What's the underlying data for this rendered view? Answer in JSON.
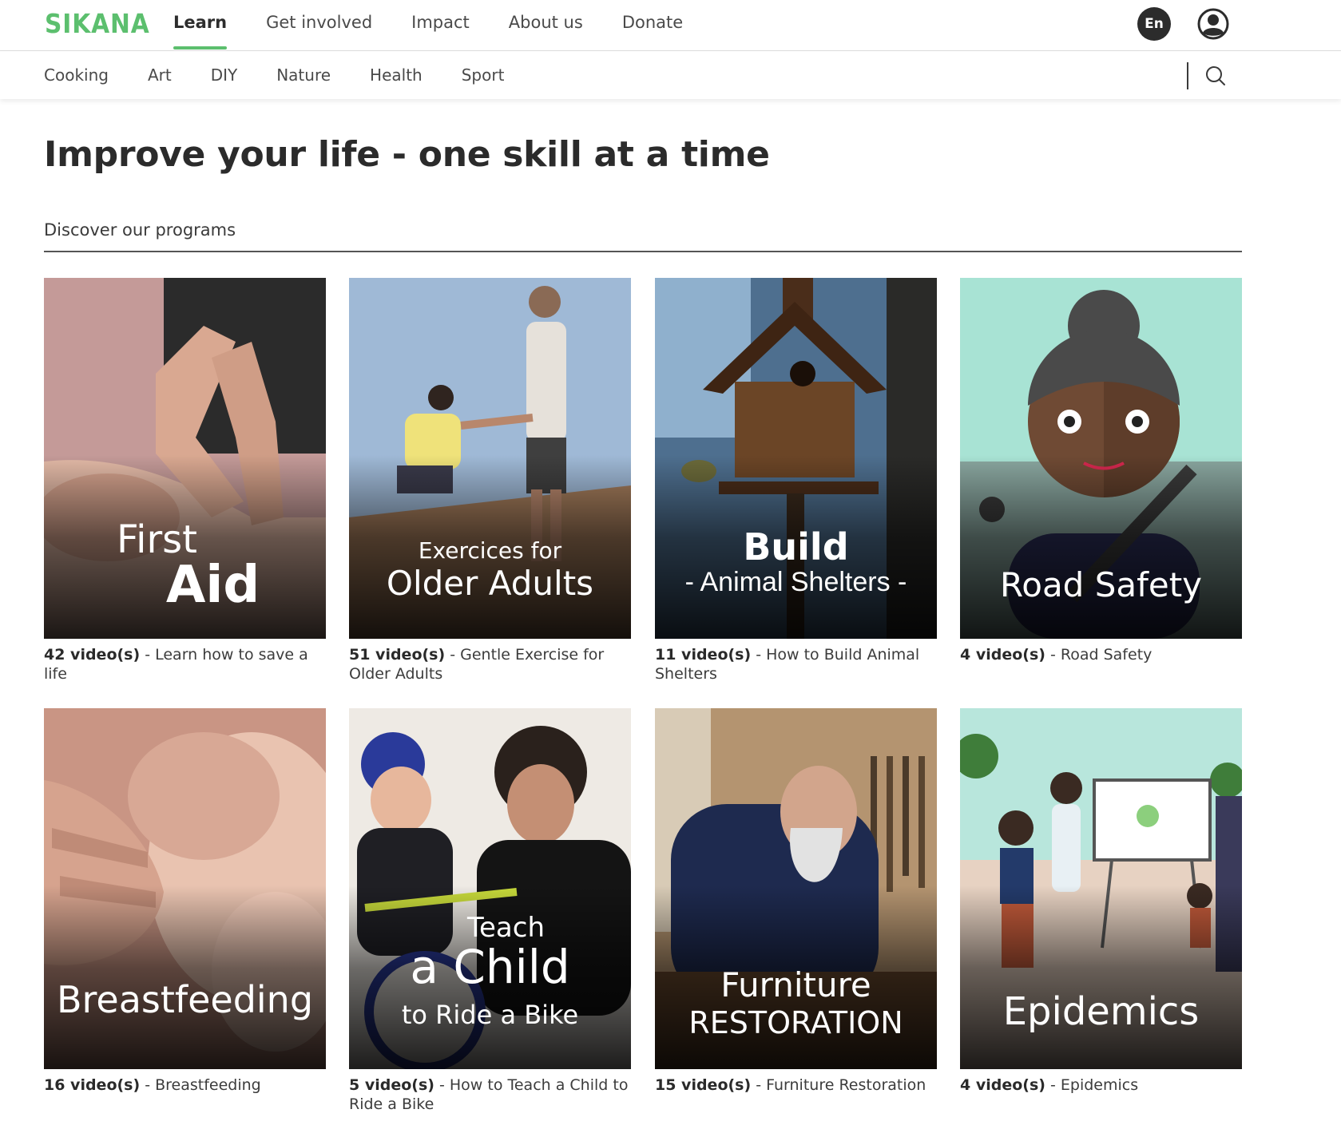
{
  "header": {
    "logo": "SIKANA",
    "nav": [
      "Learn",
      "Get involved",
      "Impact",
      "About us",
      "Donate"
    ],
    "active_nav": "Learn",
    "language": "En"
  },
  "categories": [
    "Cooking",
    "Art",
    "DIY",
    "Nature",
    "Health",
    "Sport"
  ],
  "main": {
    "title": "Improve your life - one skill at a time",
    "section_title": "Discover our programs"
  },
  "programs": [
    {
      "title_top": "First",
      "title_bottom": "Aid",
      "count": "42 video(s)",
      "desc": "Learn how to save a life"
    },
    {
      "title_top": "Exercices for",
      "title_bottom": "Older Adults",
      "count": "51 video(s)",
      "desc": "Gentle Exercise for Older Adults"
    },
    {
      "title_top": "Build",
      "title_bottom": "- Animal Shelters -",
      "count": "11 video(s)",
      "desc": "How to Build Animal Shelters"
    },
    {
      "title_top": "",
      "title_bottom": "Road Safety",
      "count": "4 video(s)",
      "desc": "Road Safety"
    },
    {
      "title_top": "",
      "title_bottom": "Breastfeeding",
      "count": "16 video(s)",
      "desc": "Breastfeeding"
    },
    {
      "title_top": "Teach",
      "title_mid": "a Child",
      "title_bottom": "to Ride a Bike",
      "count": "5 video(s)",
      "desc": "How to Teach a Child to Ride a Bike"
    },
    {
      "title_top": "Furniture",
      "title_bottom": "RESTORATION",
      "count": "15 video(s)",
      "desc": "Furniture Restoration"
    },
    {
      "title_top": "",
      "title_bottom": "Epidemics",
      "count": "4 video(s)",
      "desc": "Epidemics"
    }
  ],
  "colors": {
    "brand": "#5cbf6e",
    "text": "#2f2f2f"
  },
  "icons": {
    "search": "search-icon",
    "user": "user-avatar-icon"
  }
}
